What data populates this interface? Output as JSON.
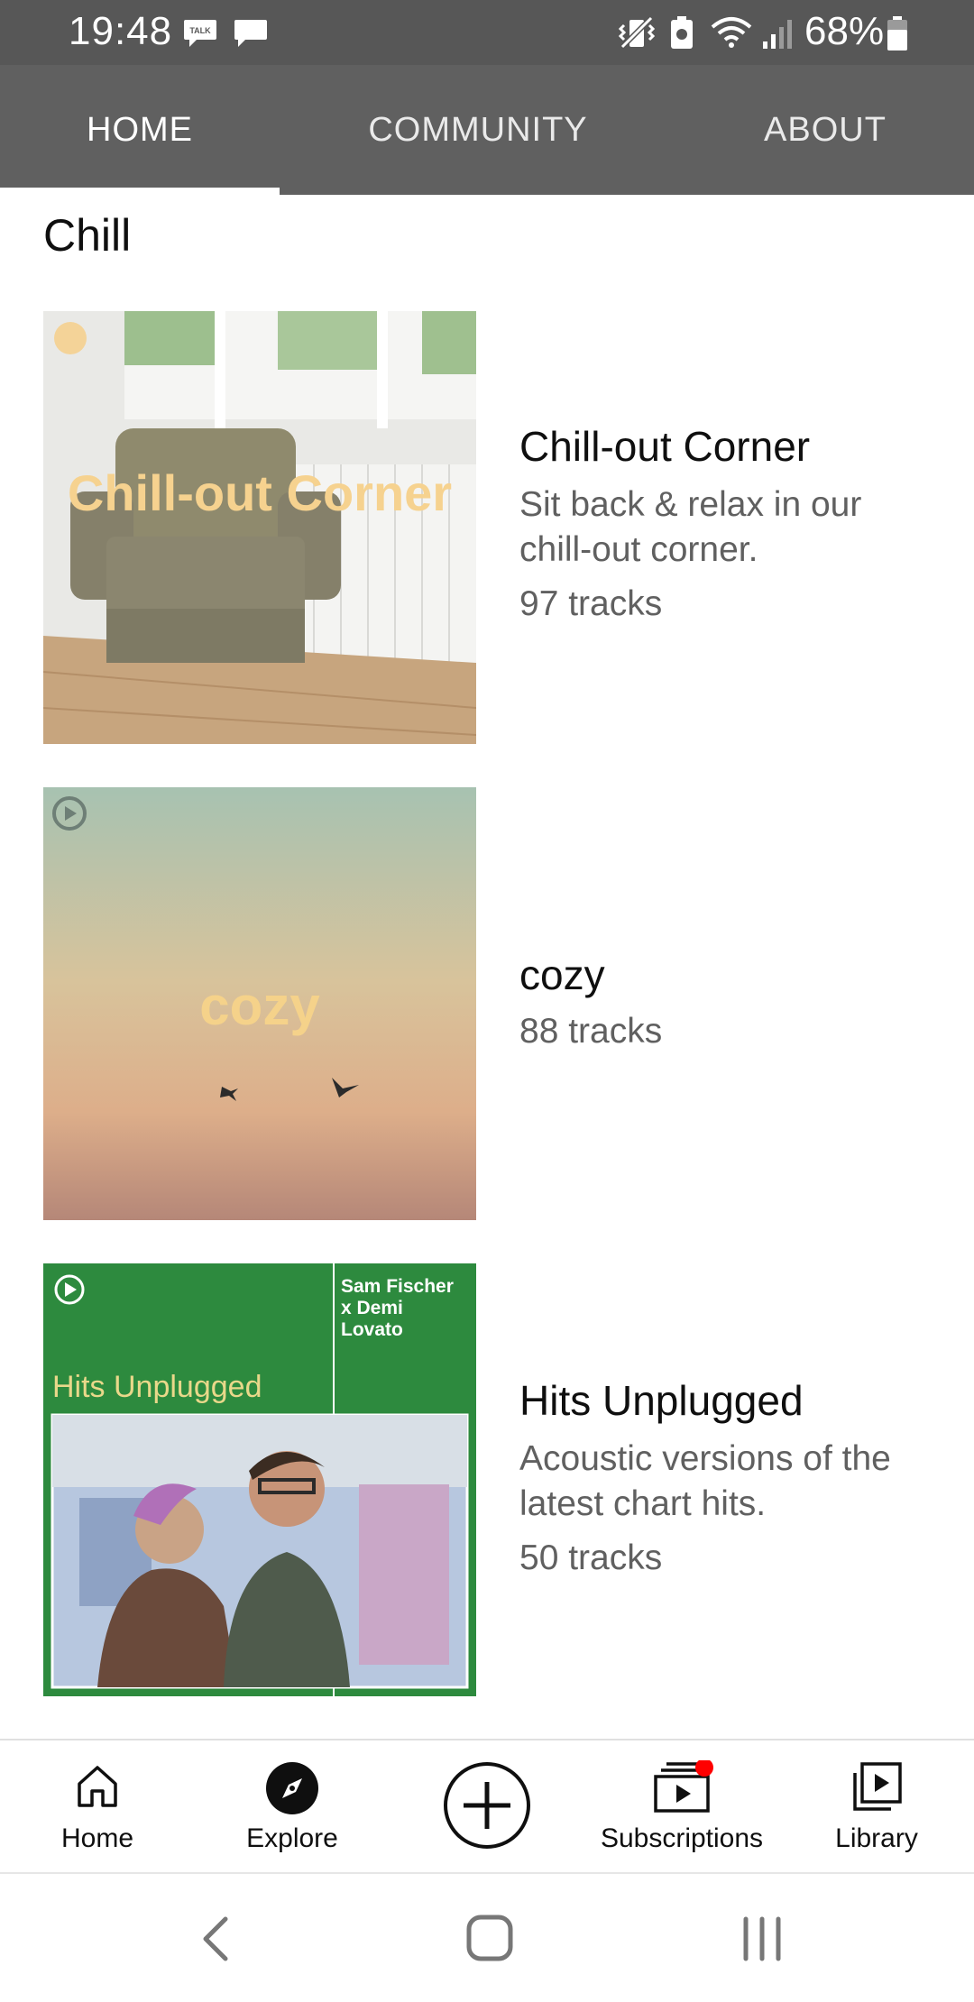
{
  "status_bar": {
    "time": "19:48",
    "talk_badge": "TALK",
    "battery": "68%",
    "icons": [
      "talk-icon",
      "message-icon",
      "vibrate-icon",
      "battery-saver-icon",
      "wifi-icon",
      "signal-icon",
      "battery-icon"
    ]
  },
  "tabs": [
    {
      "label": "HOME",
      "active": true
    },
    {
      "label": "COMMUNITY",
      "active": false
    },
    {
      "label": "ABOUT",
      "active": false
    }
  ],
  "shelf": {
    "title": "Chill",
    "playlists": [
      {
        "title": "Chill-out Corner",
        "description": "Sit back & relax in our chill-out corner.",
        "track_count": "97 tracks",
        "cover_text": "Chill-out Corner"
      },
      {
        "title": "cozy",
        "track_count": "88 tracks",
        "cover_text": "cozy"
      },
      {
        "title": "Hits Unplugged",
        "description": "Acoustic versions of the latest chart hits.",
        "track_count": "50 tracks",
        "cover_text": "Hits Unplugged",
        "cover_artist": "Sam Fischer x Demi Lovato"
      }
    ]
  },
  "bottom_nav": [
    {
      "label": "Home",
      "icon": "home-icon"
    },
    {
      "label": "Explore",
      "icon": "compass-icon"
    },
    {
      "label": "",
      "icon": "create-plus-icon"
    },
    {
      "label": "Subscriptions",
      "icon": "subscriptions-icon",
      "has_badge": true
    },
    {
      "label": "Library",
      "icon": "library-icon"
    }
  ],
  "colors": {
    "header": "#606060",
    "status_bar": "#575757",
    "accent_green": "#2d8a3e",
    "badge_red": "#ff0000"
  }
}
